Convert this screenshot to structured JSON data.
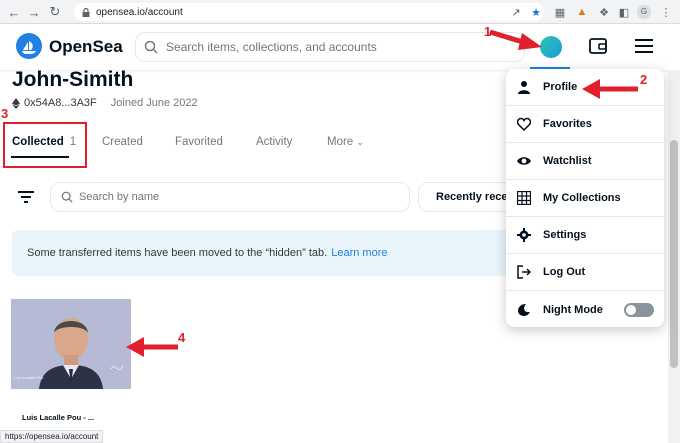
{
  "browser": {
    "url": "opensea.io/account",
    "status_url": "https://opensea.io/account"
  },
  "header": {
    "logo_text": "OpenSea",
    "search_placeholder": "Search items, collections, and accounts"
  },
  "profile": {
    "name": "John-Simith",
    "address": "0x54A8...3A3F",
    "joined": "Joined June 2022"
  },
  "tabs": [
    {
      "label": "Collected",
      "count": "1"
    },
    {
      "label": "Created"
    },
    {
      "label": "Favorited"
    },
    {
      "label": "Activity"
    },
    {
      "label": "More"
    }
  ],
  "filters": {
    "search_placeholder": "Search by name",
    "sort_label": "Recently rece"
  },
  "notice": {
    "text": "Some transferred items have been moved to the “hidden” tab.",
    "link": "Learn more"
  },
  "nft": {
    "title": "Luis Lacalle Pou - ...",
    "image_caption": "Luis Lacalle Pou"
  },
  "dropdown": {
    "items": [
      {
        "label": "Profile",
        "icon": "person-icon"
      },
      {
        "label": "Favorites",
        "icon": "heart-icon"
      },
      {
        "label": "Watchlist",
        "icon": "eye-icon"
      },
      {
        "label": "My Collections",
        "icon": "grid-icon"
      },
      {
        "label": "Settings",
        "icon": "gear-icon"
      },
      {
        "label": "Log Out",
        "icon": "logout-icon"
      },
      {
        "label": "Night Mode",
        "icon": "moon-icon"
      }
    ]
  },
  "annotations": [
    "1",
    "2",
    "3",
    "4"
  ],
  "colors": {
    "accent": "#2081e2",
    "annotation_red": "#e0202c",
    "notice_bg": "#eaf4fb"
  }
}
